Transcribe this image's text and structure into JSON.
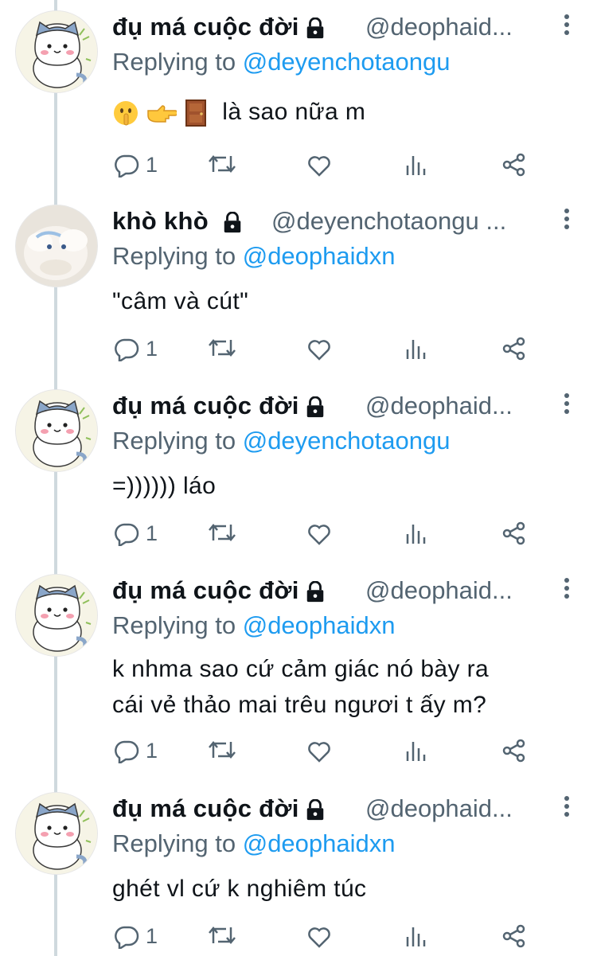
{
  "tweets": [
    {
      "avatar": "cat-avatar",
      "name": "đụ má cuộc đời",
      "handle": "@deophaid...",
      "replying_prefix": "Replying to",
      "replying_to": "@deyenchotaongu",
      "emojis": [
        "shushing-face-emoji",
        "pointing-right-emoji",
        "door-emoji"
      ],
      "text": "là sao nữa m",
      "reply_count": "1"
    },
    {
      "avatar": "cloud-dog-avatar",
      "name": "khò khò",
      "handle": "@deyenchotaongu ...",
      "replying_prefix": "Replying to",
      "replying_to": "@deophaidxn",
      "text": "\"câm và cút\"",
      "reply_count": "1"
    },
    {
      "avatar": "cat-avatar",
      "name": "đụ má cuộc đời",
      "handle": "@deophaid...",
      "replying_prefix": "Replying to",
      "replying_to": "@deyenchotaongu",
      "text": "=)))))) láo",
      "reply_count": "1"
    },
    {
      "avatar": "cat-avatar",
      "name": "đụ má cuộc đời",
      "handle": "@deophaid...",
      "replying_prefix": "Replying to",
      "replying_to": "@deophaidxn",
      "text_lines": [
        "k nhma sao cứ cảm giác nó bày ra",
        "cái vẻ thảo mai trêu ngươi t ấy m?"
      ],
      "reply_count": "1"
    },
    {
      "avatar": "cat-avatar",
      "name": "đụ má cuộc đời",
      "handle": "@deophaid...",
      "replying_prefix": "Replying to",
      "replying_to": "@deophaidxn",
      "text": "ghét vl cứ k nghiêm túc",
      "reply_count": "1"
    }
  ],
  "colors": {
    "text": "#0f1419",
    "secondary": "#536471",
    "link": "#1d9bf0",
    "thread_line": "#cfd9de"
  },
  "icons": [
    "lock-icon",
    "more-icon",
    "reply-icon",
    "retweet-icon",
    "like-icon",
    "views-icon",
    "share-icon"
  ]
}
